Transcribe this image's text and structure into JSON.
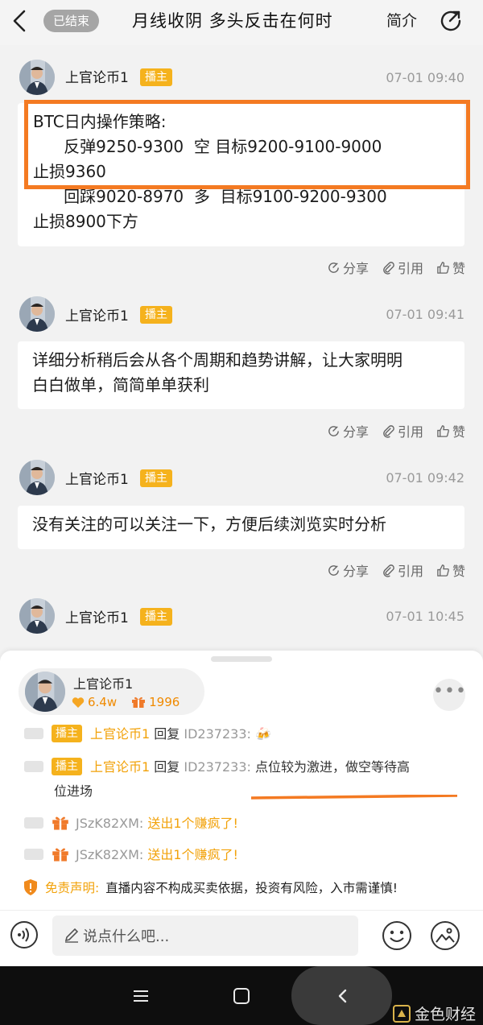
{
  "header": {
    "status_badge": "已结束",
    "title": "月线收阴 多头反击在何时",
    "intro_label": "简介"
  },
  "posts": [
    {
      "username": "上官论币1",
      "badge": "播主",
      "time": "07-01 09:40",
      "lines": [
        "BTC日内操作策略:",
        "      反弹9250-9300  空 目标9200-9100-9000",
        "止损9360",
        "      回踩9020-8970  多  目标9100-9200-9300",
        "止损8900下方"
      ]
    },
    {
      "username": "上官论币1",
      "badge": "播主",
      "time": "07-01 09:41",
      "lines": [
        "详细分析稍后会从各个周期和趋势讲解，让大家明明",
        "白白做单，简简单单获利"
      ]
    },
    {
      "username": "上官论币1",
      "badge": "播主",
      "time": "07-01 09:42",
      "lines": [
        "没有关注的可以关注一下，方便后续浏览实时分析"
      ]
    },
    {
      "username": "上官论币1",
      "badge": "播主",
      "time": "07-01 10:45",
      "lines": []
    }
  ],
  "post_actions": {
    "share": "分享",
    "quote": "引用",
    "like": "赞"
  },
  "host_card": {
    "name": "上官论币1",
    "fans": "6.4w",
    "gifts": "1996"
  },
  "chat": [
    {
      "type": "reply",
      "badge": "播主",
      "user": "上官论币1",
      "verb": "回复",
      "target": "ID237233:",
      "text": "🍻"
    },
    {
      "type": "reply",
      "badge": "播主",
      "user": "上官论币1",
      "verb": "回复",
      "target": "ID237233:",
      "text": "点位较为激进，做空等待高",
      "text2": "位进场"
    },
    {
      "type": "gift",
      "user": "JSzK82XM:",
      "text": "送出1个赚疯了!"
    },
    {
      "type": "gift",
      "user": "JSzK82XM:",
      "text": "送出1个赚疯了!"
    }
  ],
  "disclaimer": {
    "label": "免责声明:",
    "text": "直播内容不构成买卖依据，投资有风险，入市需谨慎!"
  },
  "input": {
    "placeholder": "说点什么吧..."
  },
  "watermark": "金色财经",
  "colors": {
    "accent_orange": "#f47a22",
    "badge_yellow": "#f5b21d",
    "highlight_text": "#f2a20a"
  }
}
